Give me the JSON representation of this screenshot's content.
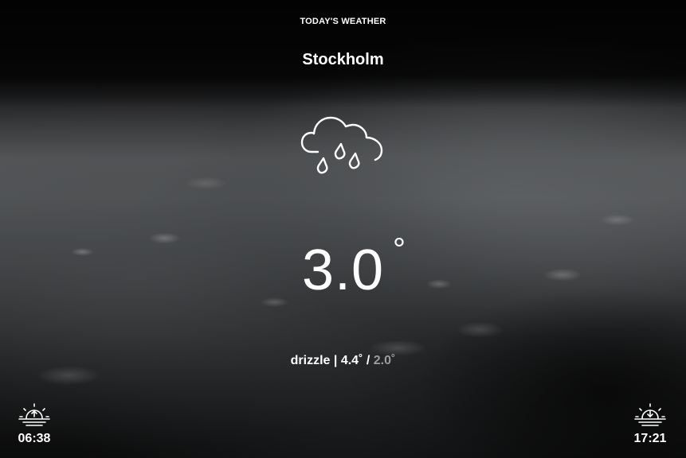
{
  "header": {
    "label": "TODAY'S WEATHER",
    "city": "Stockholm"
  },
  "current": {
    "icon": "cloud-rain-icon",
    "temperature": "3.0",
    "degree_symbol": "°"
  },
  "summary": {
    "condition": "drizzle",
    "separator": " | ",
    "high": "4.4˚",
    "slash": " / ",
    "low": "2.0˚"
  },
  "sun": {
    "sunrise_icon": "sunrise-icon",
    "sunrise": "06:38",
    "sunset_icon": "sunset-icon",
    "sunset": "17:21"
  }
}
